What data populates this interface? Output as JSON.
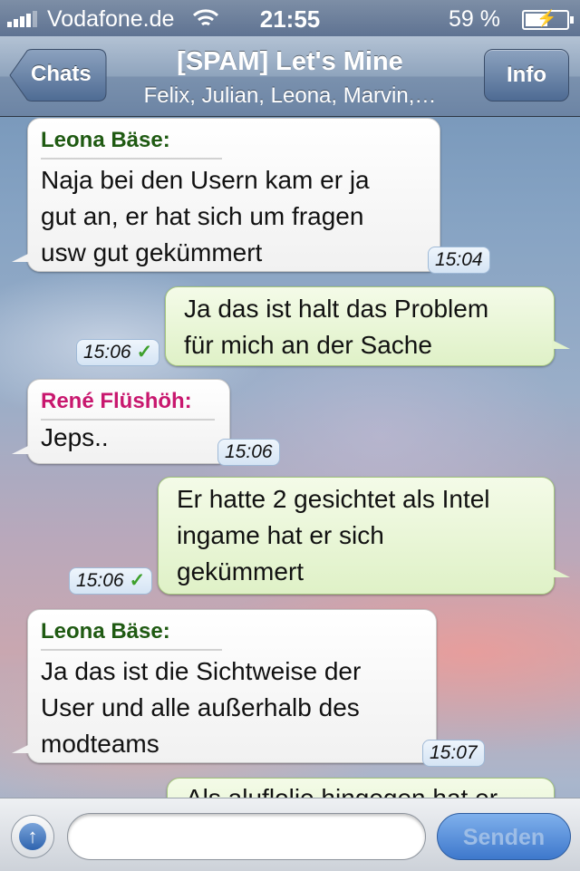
{
  "status_bar": {
    "carrier": "Vodafone.de",
    "time": "21:55",
    "battery": "59 %",
    "battery_level": 0.59,
    "icons": [
      "signal-icon",
      "wifi-icon",
      "battery-charging-icon"
    ]
  },
  "nav": {
    "back_label": "Chats",
    "title": "[SPAM] Let's Mine",
    "subtitle": "Felix, Julian, Leona, Marvin,…",
    "info_label": "Info"
  },
  "messages": [
    {
      "direction": "in",
      "sender": "Leona Bäse",
      "sender_color": "#1f5a12",
      "lines": [
        "Naja bei den Usern kam er ja",
        "gut an, er hat sich um fragen",
        "usw gut gekümmert"
      ],
      "time": "15:04"
    },
    {
      "direction": "out",
      "lines": [
        "Ja das ist halt das Problem",
        "für mich an der Sache"
      ],
      "time": "15:06",
      "delivered": "✓"
    },
    {
      "direction": "in",
      "sender": "René Flüshöh",
      "sender_color": "#c8176e",
      "lines": [
        "Jeps.."
      ],
      "time": "15:06"
    },
    {
      "direction": "out",
      "lines": [
        "Er hatte 2 gesichtet als Intel",
        "ingame hat er sich",
        "gekümmert"
      ],
      "time": "15:06",
      "delivered": "✓"
    },
    {
      "direction": "in",
      "sender": "Leona Bäse",
      "sender_color": "#1f5a12",
      "lines": [
        "Ja das ist die Sichtweise der",
        "User und alle außerhalb des",
        "modteams"
      ],
      "time": "15:07"
    },
    {
      "direction": "out",
      "lines": [
        "Als aluflolie hingegen hat er"
      ],
      "time": "",
      "partial": true
    }
  ],
  "input_bar": {
    "message_value": "",
    "send_label": "Senden",
    "accent": "#3e78cc"
  }
}
